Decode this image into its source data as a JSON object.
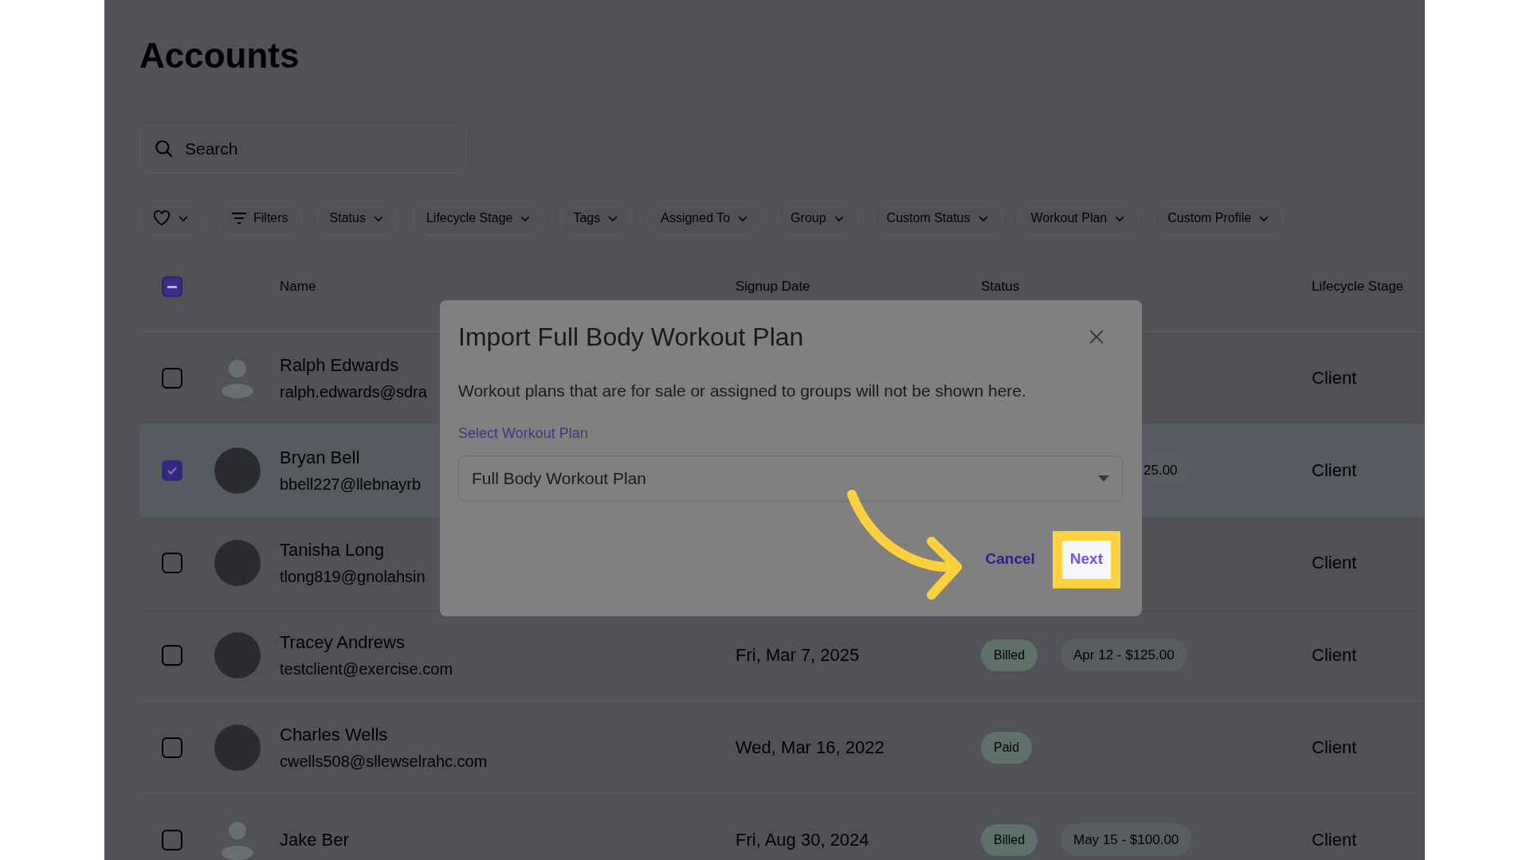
{
  "page": {
    "title": "Accounts"
  },
  "search": {
    "placeholder": "Search"
  },
  "filters": [
    {
      "kind": "favorite"
    },
    {
      "kind": "filters",
      "label": "Filters"
    },
    {
      "kind": "dropdown",
      "label": "Status"
    },
    {
      "kind": "dropdown",
      "label": "Lifecycle Stage"
    },
    {
      "kind": "dropdown",
      "label": "Tags"
    },
    {
      "kind": "dropdown",
      "label": "Assigned To"
    },
    {
      "kind": "dropdown",
      "label": "Group"
    },
    {
      "kind": "dropdown",
      "label": "Custom Status"
    },
    {
      "kind": "dropdown",
      "label": "Workout Plan"
    },
    {
      "kind": "dropdown",
      "label": "Custom Profile"
    }
  ],
  "table": {
    "header_checkbox": {
      "indeterminate": true
    },
    "columns": [
      "Name",
      "Signup Date",
      "Status",
      "Lifecycle Stage"
    ],
    "rows": [
      {
        "name": "Ralph Edwards",
        "email": "ralph.edwards@sdra",
        "has_photo": false,
        "checked": false,
        "stage": "Client"
      },
      {
        "name": "Bryan Bell",
        "email": "bbell227@llebnayrb",
        "has_photo": true,
        "checked": true,
        "billing_partial": "25.00",
        "stage": "Client"
      },
      {
        "name": "Tanisha Long",
        "email": "tlong819@gnolahsin",
        "has_photo": true,
        "checked": false,
        "stage": "Client"
      },
      {
        "name": "Tracey Andrews",
        "email": "testclient@exercise.com",
        "has_photo": true,
        "checked": false,
        "signup_date": "Fri, Mar 7, 2025",
        "status": "Billed",
        "billing": "Apr 12 - $125.00",
        "stage": "Client"
      },
      {
        "name": "Charles Wells",
        "email": "cwells508@sllewselrahc.com",
        "has_photo": true,
        "checked": false,
        "signup_date": "Wed, Mar 16, 2022",
        "status": "Paid",
        "stage": "Client"
      },
      {
        "name": "Jake Ber",
        "has_photo": false,
        "checked": false,
        "signup_date": "Fri, Aug 30, 2024",
        "status": "Billed",
        "billing": "May 15 - $100.00",
        "stage": "Client"
      }
    ]
  },
  "dialog": {
    "title": "Import Full Body Workout Plan",
    "message": "Workout plans that are for sale or assigned to groups will not be shown here.",
    "select_label": "Select Workout Plan",
    "select_value": "Full Body Workout Plan",
    "buttons": [
      {
        "label": "Cancel",
        "kind": "secondary",
        "highlighted": false
      },
      {
        "label": "Next",
        "kind": "primary",
        "highlighted": true
      }
    ]
  }
}
